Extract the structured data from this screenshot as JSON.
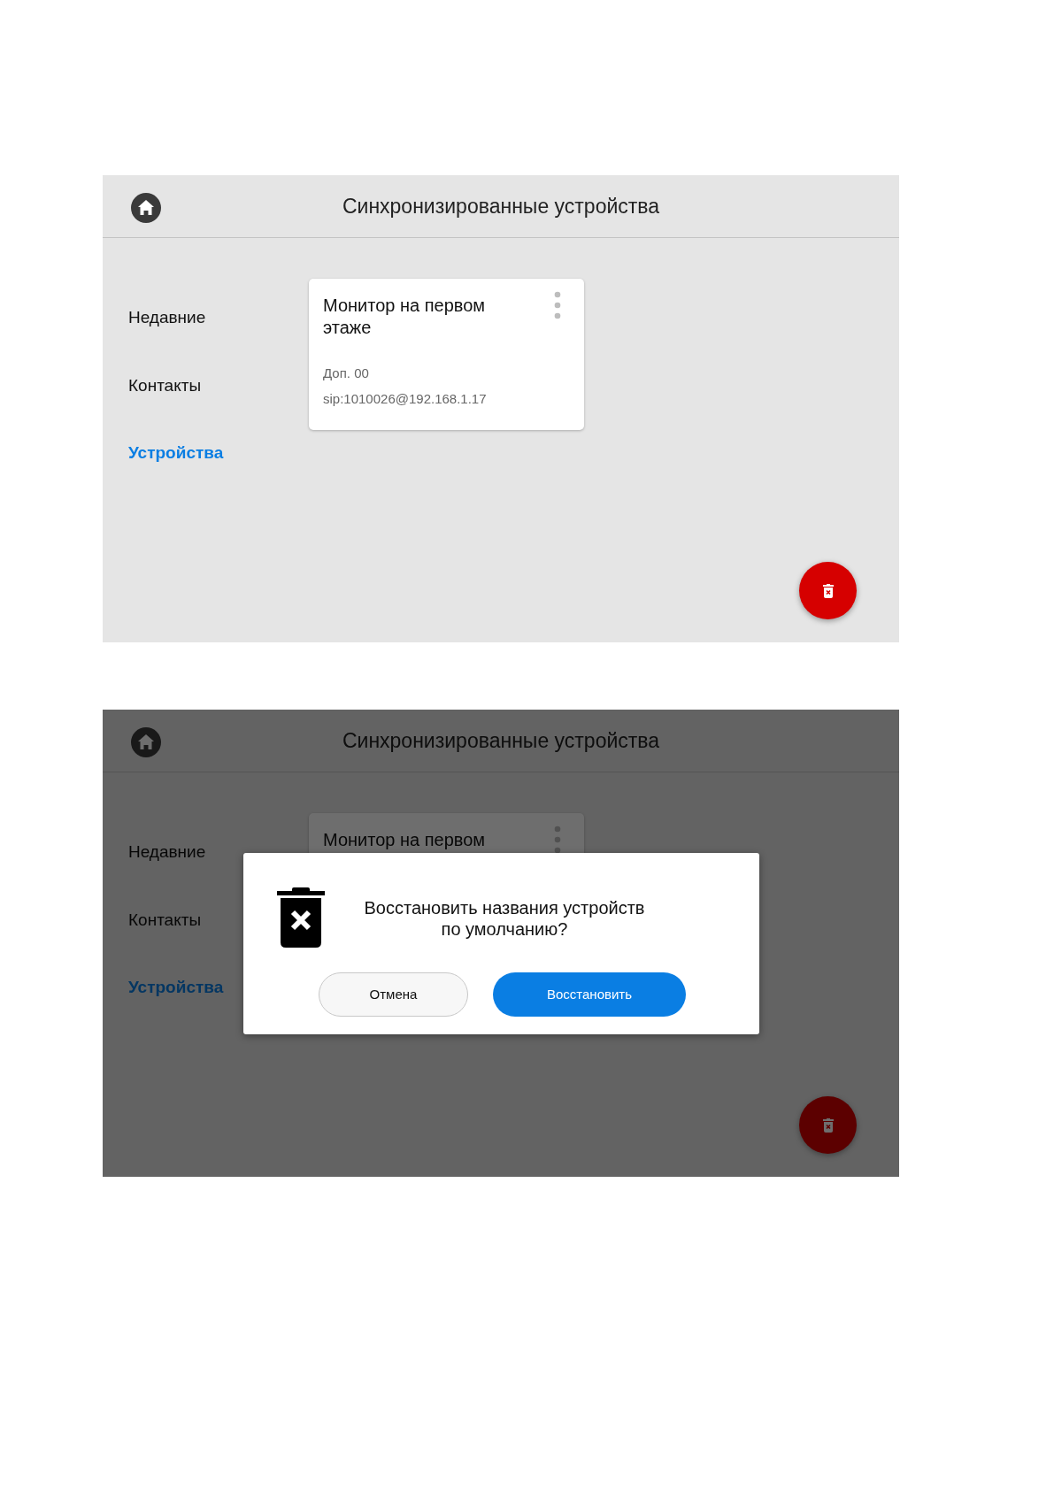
{
  "screens": [
    {
      "title": "Синхронизированные устройства",
      "nav": [
        {
          "label": "Недавние",
          "selected": false
        },
        {
          "label": "Контакты",
          "selected": false
        },
        {
          "label": "Устройства",
          "selected": true
        }
      ],
      "devices": [
        {
          "name": "Монитор на первом этаже",
          "extension": "Доп. 00",
          "address": "sip:1010026@192.168.1.17"
        }
      ]
    },
    {
      "title": "Синхронизированные устройства",
      "nav": [
        {
          "label": "Недавние",
          "selected": false
        },
        {
          "label": "Контакты",
          "selected": false
        },
        {
          "label": "Устройства",
          "selected": true
        }
      ],
      "devices": [
        {
          "name": "Монитор на первом"
        }
      ],
      "dialog": {
        "message": "Восстановить названия устройств по умолчанию?",
        "buttons": [
          {
            "label": "Отмена",
            "kind": "secondary"
          },
          {
            "label": "Восстановить",
            "kind": "primary"
          }
        ]
      }
    }
  ]
}
